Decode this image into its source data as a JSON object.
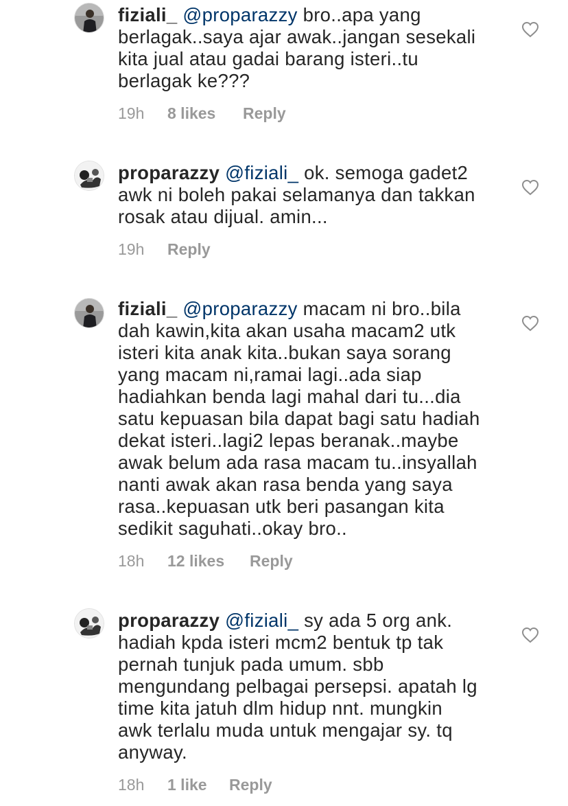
{
  "comments": [
    {
      "username": "fiziali_",
      "mention": "@proparazzy",
      "text": " bro..apa yang\nberlagak..saya ajar awak..jangan sesekali\nkita jual atau gadai barang isteri..tu\nberlagak ke???",
      "time": "19h",
      "likes": "8 likes",
      "reply": "Reply",
      "like_icon": "heart-outline-icon"
    },
    {
      "username": "proparazzy",
      "mention": "@fiziali_",
      "text": " ok. semoga gadet2\nawk ni boleh pakai selamanya dan takkan\nrosak atau dijual. amin...",
      "time": "19h",
      "likes": "",
      "reply": "Reply",
      "like_icon": "heart-outline-icon"
    },
    {
      "username": "fiziali_",
      "mention": "@proparazzy",
      "text": " macam ni bro..bila\ndah kawin,kita akan usaha macam2 utk\nisteri kita anak kita..bukan saya sorang\nyang macam ni,ramai lagi..ada siap\nhadiahkan benda lagi mahal dari tu...dia\nsatu kepuasan bila dapat bagi satu hadiah\ndekat isteri..lagi2 lepas beranak..maybe\nawak belum ada rasa macam tu..insyallah\nnanti awak akan rasa benda yang saya\nrasa..kepuasan utk beri pasangan kita\nsedikit saguhati..okay bro..",
      "time": "18h",
      "likes": "12 likes",
      "reply": "Reply",
      "like_icon": "heart-outline-icon"
    },
    {
      "username": "proparazzy",
      "mention": "@fiziali_",
      "text": " sy ada 5 org ank.\nhadiah kpda isteri mcm2 bentuk tp tak\npernah tunjuk pada umum. sbb\nmengundang pelbagai persepsi. apatah lg\ntime kita jatuh dlm hidup nnt. mungkin\nawk terlalu muda untuk mengajar sy. tq\nanyway.",
      "time": "18h",
      "likes": "1 like",
      "reply": "Reply",
      "like_icon": "heart-outline-icon"
    }
  ]
}
